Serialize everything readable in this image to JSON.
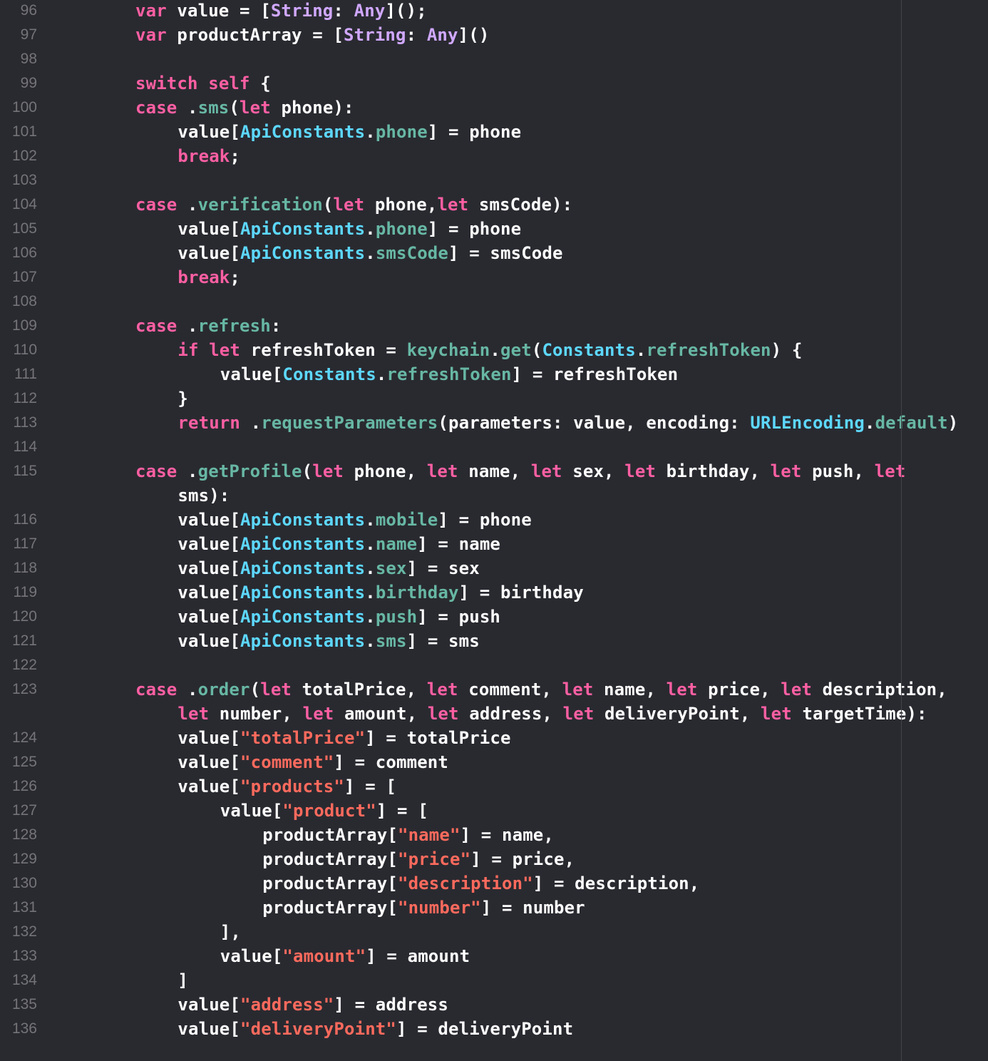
{
  "editor": {
    "colors": {
      "background": "#292a30",
      "plain": "#ffffff",
      "keyword": "#fc5fa3",
      "type": "#d0a8ff",
      "class_name": "#5dd8ff",
      "member": "#67b7a4",
      "string": "#fc6a5d",
      "line_number": "#747478",
      "page_guide": "#43444a"
    },
    "lines": [
      {
        "n": "96",
        "indent": 0,
        "tokens": [
          [
            "kw",
            "var"
          ],
          [
            "p",
            " value = ["
          ],
          [
            "typ",
            "String"
          ],
          [
            "p",
            ": "
          ],
          [
            "typ",
            "Any"
          ],
          [
            "p",
            "]();"
          ]
        ]
      },
      {
        "n": "97",
        "indent": 0,
        "tokens": [
          [
            "kw",
            "var"
          ],
          [
            "p",
            " productArray = ["
          ],
          [
            "typ",
            "String"
          ],
          [
            "p",
            ": "
          ],
          [
            "typ",
            "Any"
          ],
          [
            "p",
            "]()"
          ]
        ]
      },
      {
        "n": "98",
        "indent": 0,
        "tokens": []
      },
      {
        "n": "99",
        "indent": 0,
        "tokens": [
          [
            "kw",
            "switch"
          ],
          [
            "p",
            " "
          ],
          [
            "kw",
            "self"
          ],
          [
            "p",
            " {"
          ]
        ]
      },
      {
        "n": "100",
        "indent": 0,
        "tokens": [
          [
            "kw",
            "case"
          ],
          [
            "p",
            " ."
          ],
          [
            "mem",
            "sms"
          ],
          [
            "p",
            "("
          ],
          [
            "kw",
            "let"
          ],
          [
            "p",
            " phone):"
          ]
        ]
      },
      {
        "n": "101",
        "indent": 1,
        "tokens": [
          [
            "p",
            "value["
          ],
          [
            "cls",
            "ApiConstants"
          ],
          [
            "p",
            "."
          ],
          [
            "mem",
            "phone"
          ],
          [
            "p",
            "] = phone"
          ]
        ]
      },
      {
        "n": "102",
        "indent": 1,
        "tokens": [
          [
            "kw",
            "break"
          ],
          [
            "p",
            ";"
          ]
        ]
      },
      {
        "n": "103",
        "indent": 0,
        "tokens": []
      },
      {
        "n": "104",
        "indent": 0,
        "tokens": [
          [
            "kw",
            "case"
          ],
          [
            "p",
            " ."
          ],
          [
            "mem",
            "verification"
          ],
          [
            "p",
            "("
          ],
          [
            "kw",
            "let"
          ],
          [
            "p",
            " phone,"
          ],
          [
            "kw",
            "let"
          ],
          [
            "p",
            " smsCode):"
          ]
        ]
      },
      {
        "n": "105",
        "indent": 1,
        "tokens": [
          [
            "p",
            "value["
          ],
          [
            "cls",
            "ApiConstants"
          ],
          [
            "p",
            "."
          ],
          [
            "mem",
            "phone"
          ],
          [
            "p",
            "] = phone"
          ]
        ]
      },
      {
        "n": "106",
        "indent": 1,
        "tokens": [
          [
            "p",
            "value["
          ],
          [
            "cls",
            "ApiConstants"
          ],
          [
            "p",
            "."
          ],
          [
            "mem",
            "smsCode"
          ],
          [
            "p",
            "] = smsCode"
          ]
        ]
      },
      {
        "n": "107",
        "indent": 1,
        "tokens": [
          [
            "kw",
            "break"
          ],
          [
            "p",
            ";"
          ]
        ]
      },
      {
        "n": "108",
        "indent": 0,
        "tokens": []
      },
      {
        "n": "109",
        "indent": 0,
        "tokens": [
          [
            "kw",
            "case"
          ],
          [
            "p",
            " ."
          ],
          [
            "mem",
            "refresh"
          ],
          [
            "p",
            ":"
          ]
        ]
      },
      {
        "n": "110",
        "indent": 1,
        "tokens": [
          [
            "kw",
            "if"
          ],
          [
            "p",
            " "
          ],
          [
            "kw",
            "let"
          ],
          [
            "p",
            " refreshToken = "
          ],
          [
            "mem",
            "keychain"
          ],
          [
            "p",
            "."
          ],
          [
            "mem",
            "get"
          ],
          [
            "p",
            "("
          ],
          [
            "cls",
            "Constants"
          ],
          [
            "p",
            "."
          ],
          [
            "mem",
            "refreshToken"
          ],
          [
            "p",
            ") {"
          ]
        ]
      },
      {
        "n": "111",
        "indent": 2,
        "tokens": [
          [
            "p",
            "value["
          ],
          [
            "cls",
            "Constants"
          ],
          [
            "p",
            "."
          ],
          [
            "mem",
            "refreshToken"
          ],
          [
            "p",
            "] = refreshToken"
          ]
        ]
      },
      {
        "n": "112",
        "indent": 1,
        "tokens": [
          [
            "p",
            "}"
          ]
        ]
      },
      {
        "n": "113",
        "indent": 1,
        "tokens": [
          [
            "kw",
            "return"
          ],
          [
            "p",
            " ."
          ],
          [
            "mem",
            "requestParameters"
          ],
          [
            "p",
            "(parameters: value, encoding: "
          ],
          [
            "cls",
            "URLEncoding"
          ],
          [
            "p",
            "."
          ],
          [
            "mem",
            "default"
          ],
          [
            "p",
            ")"
          ]
        ]
      },
      {
        "n": "114",
        "indent": 0,
        "tokens": []
      },
      {
        "n": "115",
        "indent": 0,
        "tokens": [
          [
            "kw",
            "case"
          ],
          [
            "p",
            " ."
          ],
          [
            "mem",
            "getProfile"
          ],
          [
            "p",
            "("
          ],
          [
            "kw",
            "let"
          ],
          [
            "p",
            " phone, "
          ],
          [
            "kw",
            "let"
          ],
          [
            "p",
            " name, "
          ],
          [
            "kw",
            "let"
          ],
          [
            "p",
            " sex, "
          ],
          [
            "kw",
            "let"
          ],
          [
            "p",
            " birthday, "
          ],
          [
            "kw",
            "let"
          ],
          [
            "p",
            " push, "
          ],
          [
            "kw",
            "let"
          ]
        ]
      },
      {
        "n": "",
        "indent": 1,
        "tokens": [
          [
            "p",
            "sms):"
          ]
        ]
      },
      {
        "n": "116",
        "indent": 1,
        "tokens": [
          [
            "p",
            "value["
          ],
          [
            "cls",
            "ApiConstants"
          ],
          [
            "p",
            "."
          ],
          [
            "mem",
            "mobile"
          ],
          [
            "p",
            "] = phone"
          ]
        ]
      },
      {
        "n": "117",
        "indent": 1,
        "tokens": [
          [
            "p",
            "value["
          ],
          [
            "cls",
            "ApiConstants"
          ],
          [
            "p",
            "."
          ],
          [
            "mem",
            "name"
          ],
          [
            "p",
            "] = name"
          ]
        ]
      },
      {
        "n": "118",
        "indent": 1,
        "tokens": [
          [
            "p",
            "value["
          ],
          [
            "cls",
            "ApiConstants"
          ],
          [
            "p",
            "."
          ],
          [
            "mem",
            "sex"
          ],
          [
            "p",
            "] = sex"
          ]
        ]
      },
      {
        "n": "119",
        "indent": 1,
        "tokens": [
          [
            "p",
            "value["
          ],
          [
            "cls",
            "ApiConstants"
          ],
          [
            "p",
            "."
          ],
          [
            "mem",
            "birthday"
          ],
          [
            "p",
            "] = birthday"
          ]
        ]
      },
      {
        "n": "120",
        "indent": 1,
        "tokens": [
          [
            "p",
            "value["
          ],
          [
            "cls",
            "ApiConstants"
          ],
          [
            "p",
            "."
          ],
          [
            "mem",
            "push"
          ],
          [
            "p",
            "] = push"
          ]
        ]
      },
      {
        "n": "121",
        "indent": 1,
        "tokens": [
          [
            "p",
            "value["
          ],
          [
            "cls",
            "ApiConstants"
          ],
          [
            "p",
            "."
          ],
          [
            "mem",
            "sms"
          ],
          [
            "p",
            "] = sms"
          ]
        ]
      },
      {
        "n": "122",
        "indent": 0,
        "tokens": []
      },
      {
        "n": "123",
        "indent": 0,
        "tokens": [
          [
            "kw",
            "case"
          ],
          [
            "p",
            " ."
          ],
          [
            "mem",
            "order"
          ],
          [
            "p",
            "("
          ],
          [
            "kw",
            "let"
          ],
          [
            "p",
            " totalPrice, "
          ],
          [
            "kw",
            "let"
          ],
          [
            "p",
            " comment, "
          ],
          [
            "kw",
            "let"
          ],
          [
            "p",
            " name, "
          ],
          [
            "kw",
            "let"
          ],
          [
            "p",
            " price, "
          ],
          [
            "kw",
            "let"
          ],
          [
            "p",
            " description,"
          ]
        ]
      },
      {
        "n": "",
        "indent": 1,
        "tokens": [
          [
            "kw",
            "let"
          ],
          [
            "p",
            " number, "
          ],
          [
            "kw",
            "let"
          ],
          [
            "p",
            " amount, "
          ],
          [
            "kw",
            "let"
          ],
          [
            "p",
            " address, "
          ],
          [
            "kw",
            "let"
          ],
          [
            "p",
            " deliveryPoint, "
          ],
          [
            "kw",
            "let"
          ],
          [
            "p",
            " targetTime):"
          ]
        ]
      },
      {
        "n": "124",
        "indent": 1,
        "tokens": [
          [
            "p",
            "value["
          ],
          [
            "str",
            "\"totalPrice\""
          ],
          [
            "p",
            "] = totalPrice"
          ]
        ]
      },
      {
        "n": "125",
        "indent": 1,
        "tokens": [
          [
            "p",
            "value["
          ],
          [
            "str",
            "\"comment\""
          ],
          [
            "p",
            "] = comment"
          ]
        ]
      },
      {
        "n": "126",
        "indent": 1,
        "tokens": [
          [
            "p",
            "value["
          ],
          [
            "str",
            "\"products\""
          ],
          [
            "p",
            "] = ["
          ]
        ]
      },
      {
        "n": "127",
        "indent": 2,
        "tokens": [
          [
            "p",
            "value["
          ],
          [
            "str",
            "\"product\""
          ],
          [
            "p",
            "] = ["
          ]
        ]
      },
      {
        "n": "128",
        "indent": 3,
        "tokens": [
          [
            "p",
            "productArray["
          ],
          [
            "str",
            "\"name\""
          ],
          [
            "p",
            "] = name,"
          ]
        ]
      },
      {
        "n": "129",
        "indent": 3,
        "tokens": [
          [
            "p",
            "productArray["
          ],
          [
            "str",
            "\"price\""
          ],
          [
            "p",
            "] = price,"
          ]
        ]
      },
      {
        "n": "130",
        "indent": 3,
        "tokens": [
          [
            "p",
            "productArray["
          ],
          [
            "str",
            "\"description\""
          ],
          [
            "p",
            "] = description,"
          ]
        ]
      },
      {
        "n": "131",
        "indent": 3,
        "tokens": [
          [
            "p",
            "productArray["
          ],
          [
            "str",
            "\"number\""
          ],
          [
            "p",
            "] = number"
          ]
        ]
      },
      {
        "n": "132",
        "indent": 2,
        "tokens": [
          [
            "p",
            "],"
          ]
        ]
      },
      {
        "n": "133",
        "indent": 2,
        "tokens": [
          [
            "p",
            "value["
          ],
          [
            "str",
            "\"amount\""
          ],
          [
            "p",
            "] = amount"
          ]
        ]
      },
      {
        "n": "134",
        "indent": 1,
        "tokens": [
          [
            "p",
            "]"
          ]
        ]
      },
      {
        "n": "135",
        "indent": 1,
        "tokens": [
          [
            "p",
            "value["
          ],
          [
            "str",
            "\"address\""
          ],
          [
            "p",
            "] = address"
          ]
        ]
      },
      {
        "n": "136",
        "indent": 1,
        "tokens": [
          [
            "p",
            "value["
          ],
          [
            "str",
            "\"deliveryPoint\""
          ],
          [
            "p",
            "] = deliveryPoint"
          ]
        ]
      }
    ]
  }
}
